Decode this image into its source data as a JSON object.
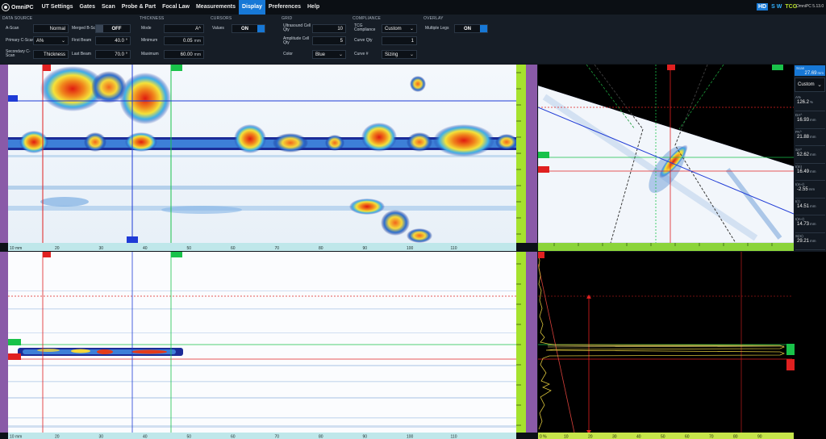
{
  "app": {
    "name": "OmniPC",
    "version": "OmniPC 5.13.0"
  },
  "menu": [
    "UT Settings",
    "Gates",
    "Scan",
    "Probe & Part",
    "Focal Law",
    "Measurements",
    "Display",
    "Preferences",
    "Help"
  ],
  "menu_active": "Display",
  "modes": {
    "hd": "HD",
    "sw": "S W",
    "tcg": "TCG"
  },
  "panel": {
    "data_source": {
      "title": "DATA SOURCE",
      "a_scan_label": "A-Scan",
      "a_scan_value": "Normal",
      "primary_cscan_label": "Primary C-Scan",
      "primary_cscan_value": "A%",
      "secondary_cscan_label": "Secondary C-Scan",
      "secondary_cscan_value": "Thickness",
      "merged_bscan_label": "Merged B-Scan",
      "merged_bscan_value": "OFF",
      "first_beam_label": "First Beam",
      "first_beam_value": "40.0 °",
      "last_beam_label": "Last Beam",
      "last_beam_value": "70.0 °"
    },
    "thickness": {
      "title": "THICKNESS",
      "mode_label": "Mode",
      "mode_value": "A^",
      "minimum_label": "Minimum",
      "minimum_value": "0.05",
      "minimum_unit": "mm",
      "maximum_label": "Maximum",
      "maximum_value": "60.00",
      "maximum_unit": "mm"
    },
    "cursors": {
      "title": "CURSORS",
      "values_label": "Values",
      "values_value": "ON"
    },
    "grid": {
      "title": "GRID",
      "ut_cell_label": "Ultrasound Cell Qty",
      "ut_cell_value": "10",
      "amp_cell_label": "Amplitude Cell Qty",
      "amp_cell_value": "5",
      "color_label": "Color",
      "color_value": "Blue"
    },
    "compliance": {
      "title": "COMPLIANCE",
      "tcg_label": "TCG Compliance",
      "tcg_value": "Custom",
      "curve_qty_label": "Curve Qty",
      "curve_qty_value": "1",
      "curve_num_label": "Curve #",
      "curve_num_value": "Sizing"
    },
    "overlay": {
      "title": "OVERLAY",
      "multiple_legs_label": "Multiple Legs",
      "multiple_legs_value": "ON"
    }
  },
  "readouts": {
    "scan_label": "Scan",
    "scan_value": "27.69",
    "scan_unit": "mm",
    "preset": "Custom",
    "items": [
      {
        "label": "A%",
        "value": "126.2",
        "unit": "%"
      },
      {
        "label": "DA^",
        "value": "16.93",
        "unit": "mm"
      },
      {
        "label": "PA^",
        "value": "21.88",
        "unit": "mm"
      },
      {
        "label": "SA^",
        "value": "52.62",
        "unit": "mm"
      },
      {
        "label": "I(m)",
        "value": "16.49",
        "unit": "mm"
      },
      {
        "label": "I(m-r)",
        "value": "-2.55",
        "unit": "mm"
      },
      {
        "label": "I(r)",
        "value": "14.51",
        "unit": "mm"
      },
      {
        "label": "I(m-r)",
        "value": "14.73",
        "unit": "mm"
      },
      {
        "label": "S(m)",
        "value": "29.21",
        "unit": "mm"
      },
      {
        "label": "I(m)",
        "value": "16.49",
        "unit": "mm"
      }
    ]
  },
  "axes": {
    "scan_ticks": [
      "10",
      "20",
      "30",
      "40",
      "50",
      "60",
      "70",
      "80",
      "90",
      "100",
      "110"
    ],
    "scan_start": "10 mm",
    "ascan_ticks": [
      "0 %",
      "10",
      "20",
      "30",
      "40",
      "50",
      "60",
      "70",
      "80",
      "90"
    ]
  },
  "colors": {
    "accent": "#1778d6",
    "gate_green": "#19c24a",
    "gate_red": "#e02020",
    "cursor_blue": "#1f3bd6",
    "ruler_green": "#a6e22e",
    "ruler_purple": "#8a5aa8"
  }
}
